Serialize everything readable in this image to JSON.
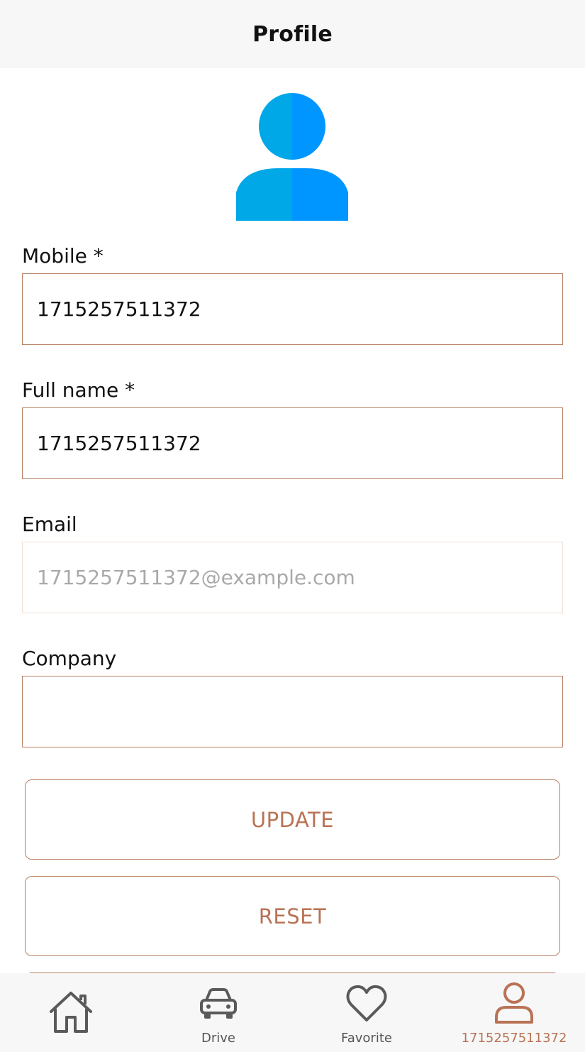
{
  "header": {
    "title": "Profile"
  },
  "avatar": {
    "icon": "user-avatar-icon",
    "color_left": "#00a8e8",
    "color_right": "#0096ff"
  },
  "form": {
    "mobile": {
      "label": "Mobile *",
      "value": "1715257511372"
    },
    "full_name": {
      "label": "Full name *",
      "value": "1715257511372"
    },
    "email": {
      "label": "Email",
      "value": "1715257511372@example.com",
      "disabled": true
    },
    "company": {
      "label": "Company",
      "value": ""
    }
  },
  "buttons": {
    "update_label": "UPDATE",
    "reset_label": "RESET"
  },
  "bottom_nav": {
    "items": [
      {
        "icon": "home-icon",
        "label": ""
      },
      {
        "icon": "car-icon",
        "label": "Drive"
      },
      {
        "icon": "heart-icon",
        "label": "Favorite"
      },
      {
        "icon": "person-icon",
        "label": "1715257511372",
        "active": true
      }
    ]
  },
  "colors": {
    "accent": "#b87355",
    "border": "#b87f62",
    "disabled_border": "#eedfd5",
    "nav_background": "#f7f7f7",
    "icon_gray": "#5a5a5a"
  }
}
